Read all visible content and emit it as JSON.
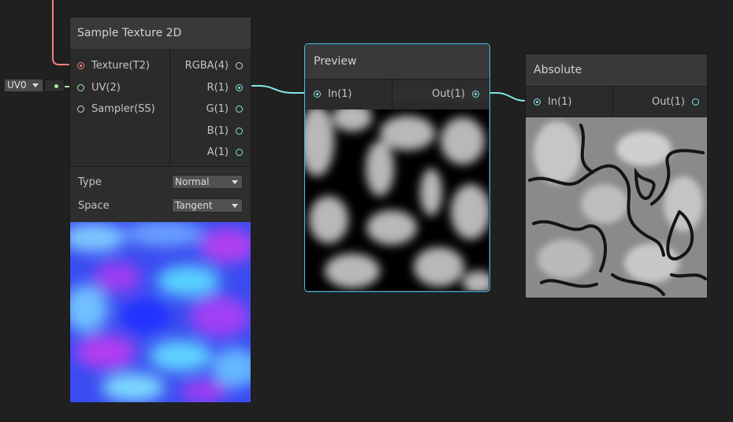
{
  "nodes": {
    "sample_texture": {
      "title": "Sample Texture 2D",
      "inputs": [
        "Texture(T2)",
        "UV(2)",
        "Sampler(SS)"
      ],
      "outputs": [
        "RGBA(4)",
        "R(1)",
        "G(1)",
        "B(1)",
        "A(1)"
      ],
      "type_label": "Type",
      "type_value": "Normal",
      "space_label": "Space",
      "space_value": "Tangent"
    },
    "preview": {
      "title": "Preview",
      "input": "In(1)",
      "output": "Out(1)"
    },
    "absolute": {
      "title": "Absolute",
      "input": "In(1)",
      "output": "Out(1)"
    }
  },
  "uv_chip": {
    "label": "UV0"
  },
  "colors": {
    "canvas": "#202020",
    "node_body": "#2b2b2b",
    "node_header": "#393939",
    "texture_port": "#f08080",
    "vector2_port": "#9ff09f",
    "vector1_port": "#84e4e7",
    "selection": "#44c0ef"
  }
}
